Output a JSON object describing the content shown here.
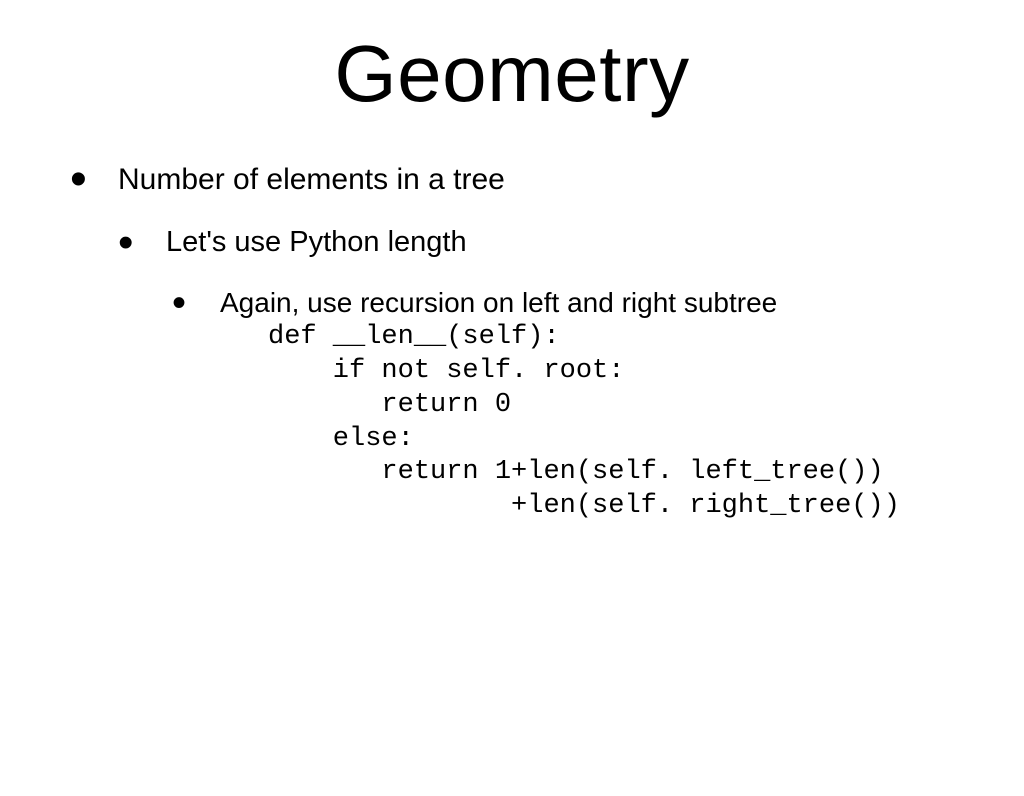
{
  "title": "Geometry",
  "bullets": {
    "l1": "Number of elements in a tree",
    "l2": "Let's use Python length",
    "l3": "Again, use recursion on left and right subtree"
  },
  "code": "def __len__(self):\n    if not self. root:\n       return 0\n    else:\n       return 1+len(self. left_tree())\n               +len(self. right_tree())"
}
